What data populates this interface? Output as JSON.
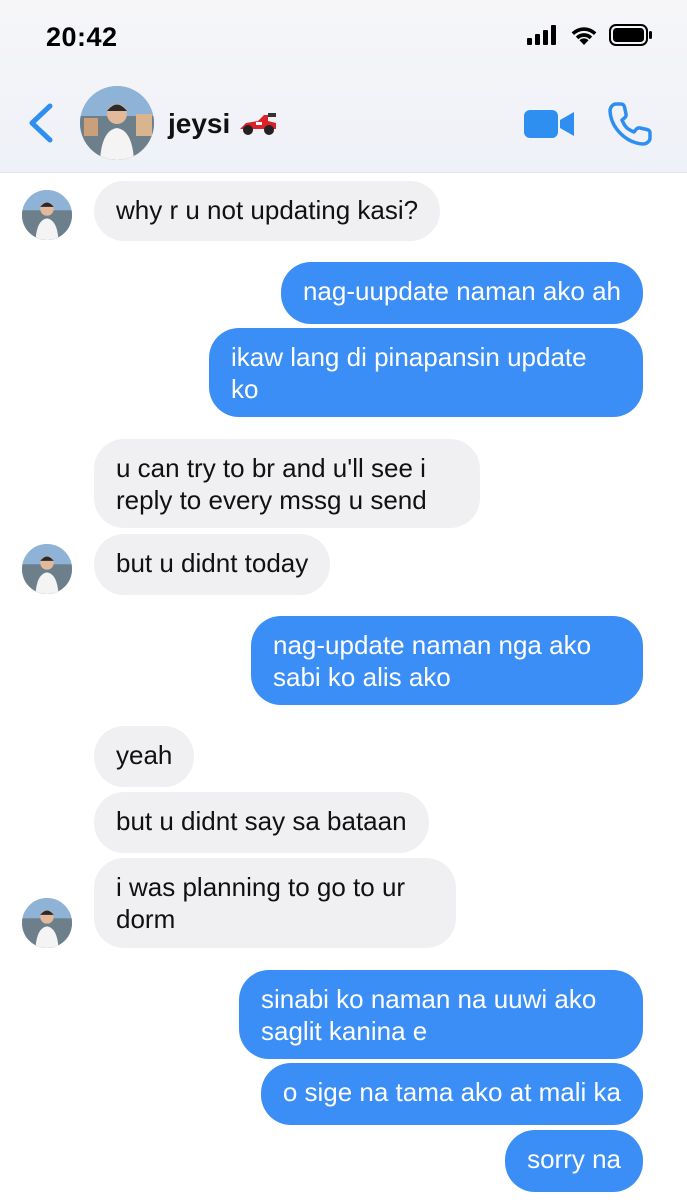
{
  "status_bar": {
    "time": "20:42"
  },
  "header": {
    "contact_name": "jeysi",
    "icons": [
      "back-chevron-icon",
      "video-call-icon",
      "phone-call-icon",
      "race-car-emoji"
    ],
    "accent_color": "#2f8ff1"
  },
  "colors": {
    "incoming_bubble": "#f0f0f3",
    "outgoing_bubble": "#3b8ef5"
  },
  "messages": [
    {
      "from": "contact",
      "text": "why r u not updating kasi?"
    },
    {
      "from": "me",
      "text": "nag-uupdate naman ako ah"
    },
    {
      "from": "me",
      "text": "ikaw lang di pinapansin update ko"
    },
    {
      "from": "contact",
      "text": "u can try to br and u'll see i reply to every mssg u send"
    },
    {
      "from": "contact",
      "text": "but u didnt today"
    },
    {
      "from": "me",
      "text": "nag-update naman nga ako sabi ko alis ako"
    },
    {
      "from": "contact",
      "text": "yeah"
    },
    {
      "from": "contact",
      "text": "but u didnt say sa bataan"
    },
    {
      "from": "contact",
      "text": "i was planning to go to ur dorm"
    },
    {
      "from": "me",
      "text": "sinabi ko naman na uuwi ako saglit kanina e"
    },
    {
      "from": "me",
      "text": "o sige na tama ako at mali ka"
    },
    {
      "from": "me",
      "text": "sorry na"
    }
  ]
}
